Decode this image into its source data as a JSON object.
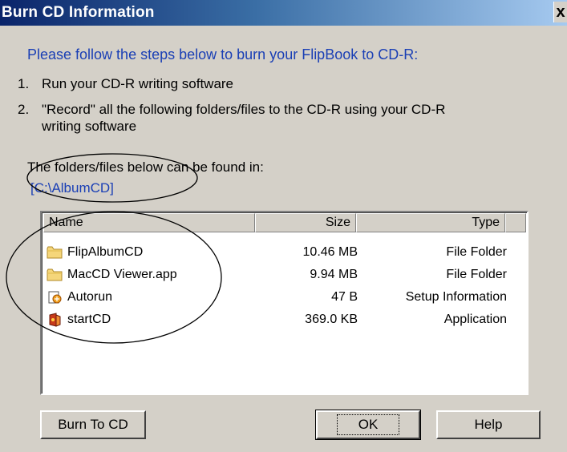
{
  "window": {
    "title": "Burn CD Information",
    "close_label": "x"
  },
  "intro": "Please follow the steps below to burn your FlipBook to CD-R:",
  "steps": [
    {
      "num": "1.",
      "text": "Run your CD-R writing software"
    },
    {
      "num": "2.",
      "text_line1": "\"Record\" all the following folders/files to the CD-R using your CD-R",
      "text_line2": "writing software"
    }
  ],
  "found_label": "The folders/files below can be found in:",
  "path": "[C:\\AlbumCD]",
  "list": {
    "headers": {
      "name": "Name",
      "size": "Size",
      "type": "Type"
    },
    "rows": [
      {
        "icon": "folder-icon",
        "name": "FlipAlbumCD",
        "size": "10.46 MB",
        "type": "File Folder"
      },
      {
        "icon": "folder-icon",
        "name": "MacCD Viewer.app",
        "size": "9.94 MB",
        "type": "File Folder"
      },
      {
        "icon": "setup-info-icon",
        "name": "Autorun",
        "size": "47 B",
        "type": "Setup Information"
      },
      {
        "icon": "application-icon",
        "name": "startCD",
        "size": "369.0 KB",
        "type": "Application"
      }
    ]
  },
  "buttons": {
    "burn": "Burn To CD",
    "ok": "OK",
    "help": "Help"
  },
  "colors": {
    "title_gradient_start": "#0a246a",
    "link_blue": "#1a3fb5",
    "dialog_bg": "#d4d0c8"
  }
}
